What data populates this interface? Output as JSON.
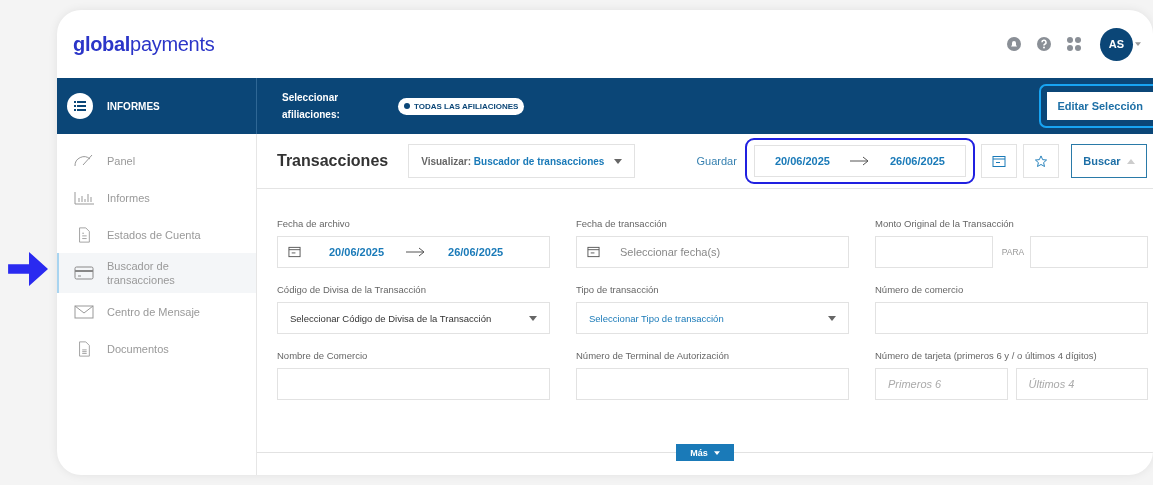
{
  "header": {
    "logo": "**global**payments",
    "avatar": "AS"
  },
  "nav_bar": {
    "section": "INFORMES",
    "affiliation_label": "Seleccionar afiliaciones:",
    "affiliation_chip": "TODAS LAS AFILIACIONES",
    "edit_button": "Editar Selección"
  },
  "sidebar": {
    "items": [
      {
        "label": "Panel",
        "selected": false
      },
      {
        "label": "Informes",
        "selected": false
      },
      {
        "label": "Estados de Cuenta",
        "selected": false
      },
      {
        "label": "Buscador de transacciones",
        "selected": true
      },
      {
        "label": "Centro de Mensaje",
        "selected": false
      },
      {
        "label": "Documentos",
        "selected": false
      }
    ]
  },
  "toolbar": {
    "title": "Transacciones",
    "view_label": "Visualizar:",
    "view_value": "Buscador de transacciones",
    "save": "Guardar",
    "date_from": "20/06/2025",
    "date_to": "26/06/2025",
    "search_button": "Buscar"
  },
  "fields": [
    {
      "kind": "date_range",
      "label": "Fecha de archivo",
      "from": "20/06/2025",
      "to": "26/06/2025"
    },
    {
      "kind": "date",
      "label": "Fecha de transacción",
      "placeholder": "Seleccionar fecha(s)"
    },
    {
      "kind": "range",
      "label": "Monto Original de la Transacción",
      "separator": "PARA"
    },
    {
      "kind": "select",
      "label": "Código de Divisa de la Transacción",
      "value": "Seleccionar Código de Divisa de la Transacción",
      "accent": false
    },
    {
      "kind": "select",
      "label": "Tipo de transacción",
      "value": "Seleccionar Tipo de transacción",
      "accent": true
    },
    {
      "kind": "text",
      "label": "Número de comercio"
    },
    {
      "kind": "text",
      "label": "Nombre de Comercio"
    },
    {
      "kind": "text",
      "label": "Número de Terminal de Autorización"
    },
    {
      "kind": "split",
      "label": "Número de tarjeta (primeros 6 y / o últimos 4 dígitos)",
      "placeholder_1": "Primeros 6",
      "placeholder_2": "Últimos 4"
    }
  ],
  "more_button": "Más"
}
